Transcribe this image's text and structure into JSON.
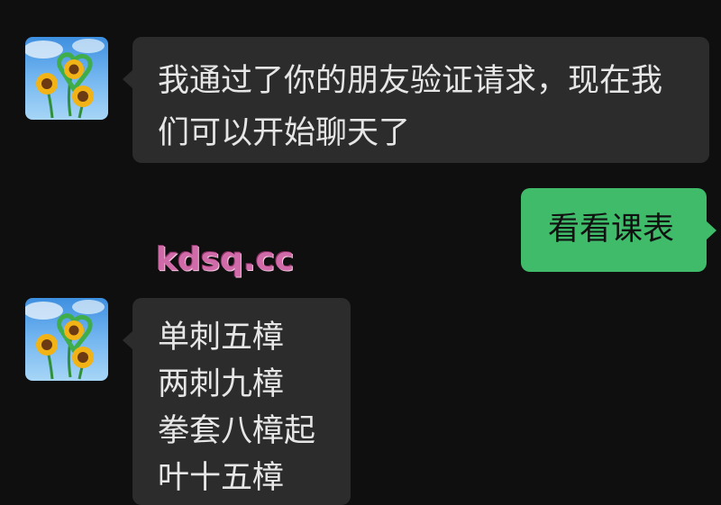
{
  "messages": [
    {
      "side": "left",
      "lines": [
        "我通过了你的朋友验证请求，现在我",
        "们可以开始聊天了"
      ]
    },
    {
      "side": "right",
      "lines": [
        "看看课表"
      ]
    },
    {
      "side": "left",
      "lines": [
        "单刺五樟",
        "两刺九樟",
        "拳套八樟起",
        "叶十五樟"
      ]
    }
  ],
  "watermark": "kdsq.cc",
  "avatar_icon": "sunflower-heart-avatar",
  "colors": {
    "background": "#0f0f0f",
    "incoming_bubble": "#2c2c2c",
    "outgoing_bubble": "#3fbb6a"
  }
}
